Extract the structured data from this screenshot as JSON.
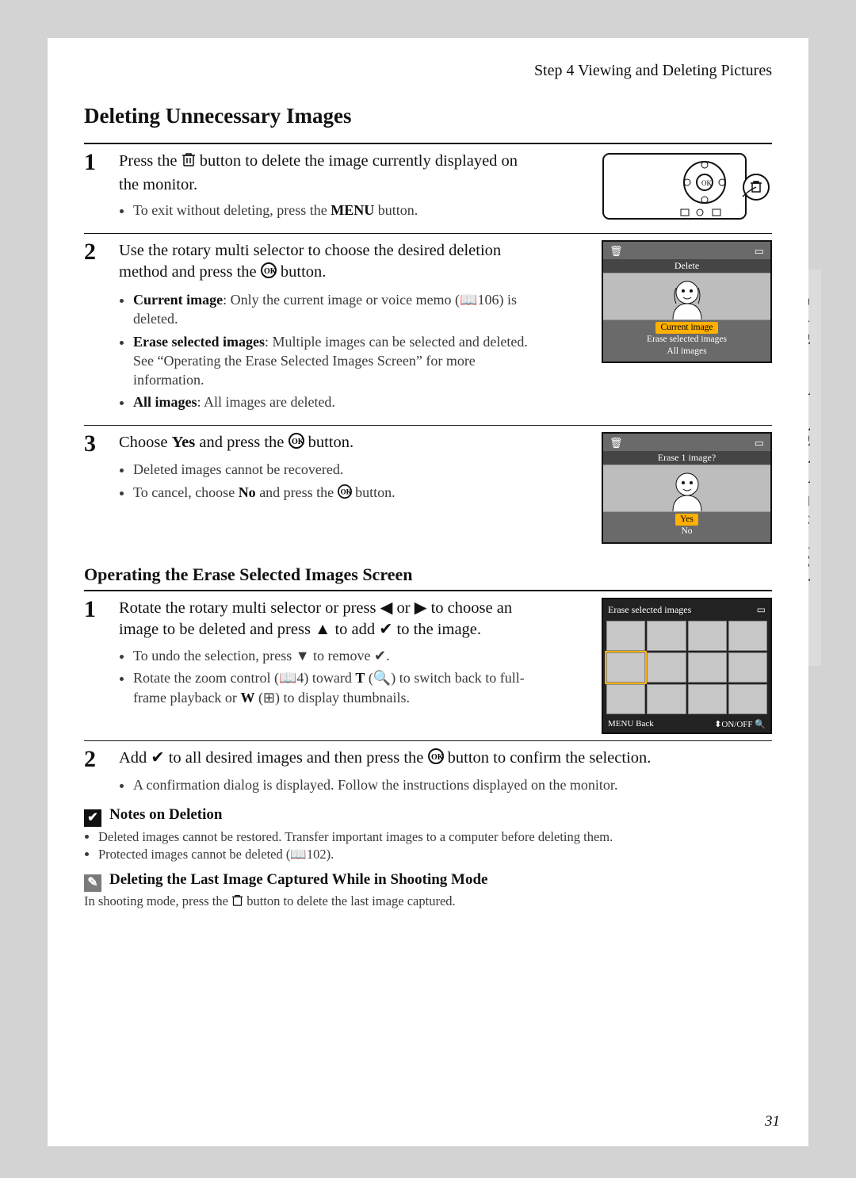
{
  "header": "Step 4 Viewing and Deleting Pictures",
  "title": "Deleting Unnecessary Images",
  "side_text": "Basic Photography and Playback: 🞏 (Auto) Mode",
  "page_number": "31",
  "steps_a": {
    "s1": {
      "num": "1",
      "main_a": "Press the ",
      "main_b": " button to delete the image currently displayed on the monitor.",
      "b1_a": "To exit without deleting, press the ",
      "b1_menu": "MENU",
      "b1_b": " button."
    },
    "s2": {
      "num": "2",
      "main_a": "Use the rotary multi selector to choose the desired deletion method and press the ",
      "main_b": " button.",
      "b1_label": "Current image",
      "b1_text": ": Only the current image or voice memo (📖106) is deleted.",
      "b2_label": "Erase selected images",
      "b2_text": ": Multiple images can be selected and deleted. See “Operating the Erase Selected Images Screen” for more information.",
      "b3_label": "All images",
      "b3_text": ": All images are deleted."
    },
    "s3": {
      "num": "3",
      "main_a": "Choose ",
      "main_yes": "Yes",
      "main_b": " and press the ",
      "main_c": " button.",
      "b1": "Deleted images cannot be recovered.",
      "b2_a": "To cancel, choose ",
      "b2_no": "No",
      "b2_b": " and press the ",
      "b2_c": " button."
    }
  },
  "screen2": {
    "title": "Delete",
    "opt1": "Current image",
    "opt2": "Erase selected images",
    "opt3": "All images"
  },
  "screen3": {
    "title": "Erase 1 image?",
    "yes": "Yes",
    "no": "No"
  },
  "sub_title": "Operating the Erase Selected Images Screen",
  "steps_b": {
    "s1": {
      "num": "1",
      "main": "Rotate the rotary multi selector or press ◀ or ▶ to choose an image to be deleted and press ▲ to add ✔ to the image.",
      "b1": "To undo the selection, press ▼ to remove ✔.",
      "b2_a": "Rotate the zoom control (📖4) toward ",
      "b2_t": "T",
      "b2_mid": " (🔍) to switch back to full-frame playback or ",
      "b2_w": "W",
      "b2_end": " (⊞) to display thumbnails."
    },
    "s2": {
      "num": "2",
      "main_a": "Add ✔ to all desired images and then press the ",
      "main_b": " button to confirm the selection.",
      "b1": "A confirmation dialog is displayed. Follow the instructions displayed on the monitor."
    }
  },
  "screen4": {
    "title": "Erase selected images",
    "back_label": "MENU Back",
    "onoff": "⬍ON/OFF  🔍"
  },
  "notes1": {
    "icon": "✔",
    "title": "Notes on Deletion",
    "b1": "Deleted images cannot be restored. Transfer important images to a computer before deleting them.",
    "b2": "Protected images cannot be deleted (📖102)."
  },
  "notes2": {
    "icon": "✎",
    "title": "Deleting the Last Image Captured While in Shooting Mode",
    "text_a": "In shooting mode, press the ",
    "text_b": " button to delete the last image captured."
  }
}
